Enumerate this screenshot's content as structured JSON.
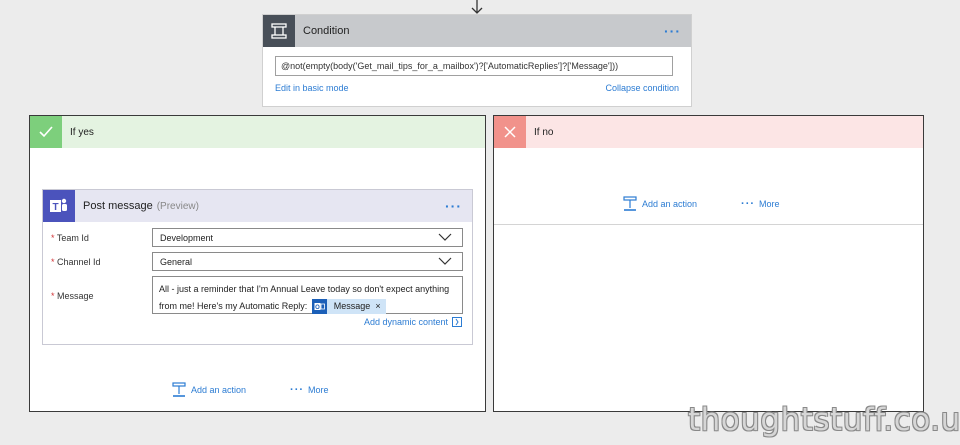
{
  "condition": {
    "title": "Condition",
    "more_label": "···",
    "expression": "@not(empty(body('Get_mail_tips_for_a_mailbox')?['AutomaticReplies']?['Message']))",
    "edit_basic_label": "Edit in basic mode",
    "collapse_label": "Collapse condition"
  },
  "if_yes": {
    "title": "If yes",
    "add_action_label": "Add an action",
    "more_label": "More",
    "post_message": {
      "title": "Post message",
      "subtitle": "(Preview)",
      "more_label": "···",
      "team_id": {
        "label": "Team Id",
        "value": "Development"
      },
      "channel_id": {
        "label": "Channel Id",
        "value": "General"
      },
      "message": {
        "label": "Message",
        "text": "All - just a reminder that I'm Annual Leave today so don't expect anything from me! Here's my Automatic Reply:",
        "token_label": "Message",
        "token_remove": "×"
      },
      "dynamic_content_label": "Add dynamic content"
    }
  },
  "if_no": {
    "title": "If no",
    "add_action_label": "Add an action",
    "more_label": "More"
  },
  "watermark": "thoughtstuff.co.uk",
  "colors": {
    "accent": "#2c7cd3",
    "yes_green": "#7dcf7c",
    "no_red": "#f1928b",
    "teams_purple": "#4b53bc",
    "outlook_blue": "#1b5fb8"
  }
}
